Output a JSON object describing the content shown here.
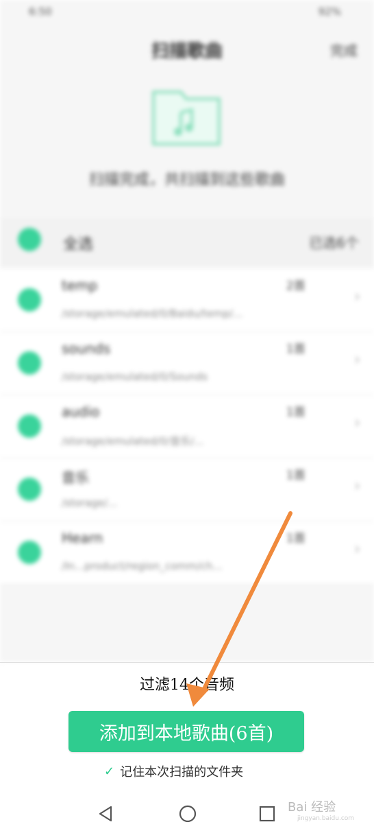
{
  "status_bar": {
    "left": "6:50",
    "right": "92%"
  },
  "header": {
    "title": "扫描歌曲",
    "action": "完成"
  },
  "hint": "扫描完成，共扫描到这些歌曲",
  "select_all": {
    "label": "全选",
    "count": "已选6个"
  },
  "folders": [
    {
      "name": "temp",
      "count": "2首",
      "path": "/storage/emulated/0/Baidu/temp/..."
    },
    {
      "name": "sounds",
      "count": "1首",
      "path": "/storage/emulated/0/Sounds"
    },
    {
      "name": "audio",
      "count": "1首",
      "path": "/storage/emulated/0/音乐/..."
    },
    {
      "name": "音乐",
      "count": "1首",
      "path": "/storage/..."
    },
    {
      "name": "Hearn",
      "count": "1首",
      "path": "/In...product/region_comm/ch..."
    }
  ],
  "filter_text": "过滤14个音频",
  "add_button_label": "添加到本地歌曲(6首)",
  "remember_label": "记住本次扫描的文件夹",
  "watermark": {
    "text": "Bai 经验",
    "sub": "jingyan.baidu.com"
  },
  "colors": {
    "accent": "#2fcc8f",
    "arrow": "#f08a3c"
  }
}
